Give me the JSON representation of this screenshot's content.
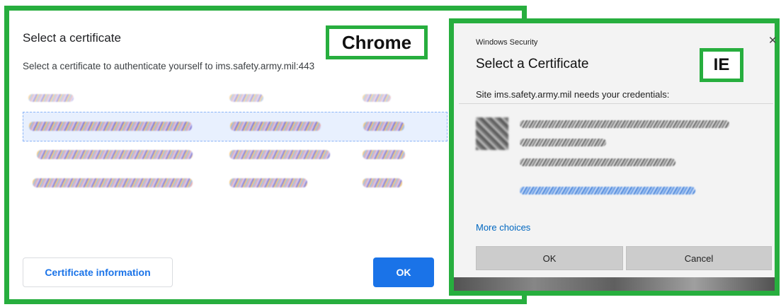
{
  "chrome": {
    "tag": "Chrome",
    "title": "Select a certificate",
    "subtitle": "Select a certificate to authenticate yourself to ims.safety.army.mil:443",
    "info_button": "Certificate information",
    "ok_button": "OK",
    "rows": 4,
    "selected_row": 1,
    "accent": "#1a73e8",
    "frame_color": "#27ae3e"
  },
  "ie": {
    "tag": "IE",
    "window_title": "Windows Security",
    "close_glyph": "✕",
    "heading": "Select a Certificate",
    "site_text": "Site ims.safety.army.mil needs your credentials:",
    "more_choices": "More choices",
    "ok_button": "OK",
    "cancel_button": "Cancel",
    "link_color": "#0067c0",
    "cert_icon": "certificate-icon"
  }
}
